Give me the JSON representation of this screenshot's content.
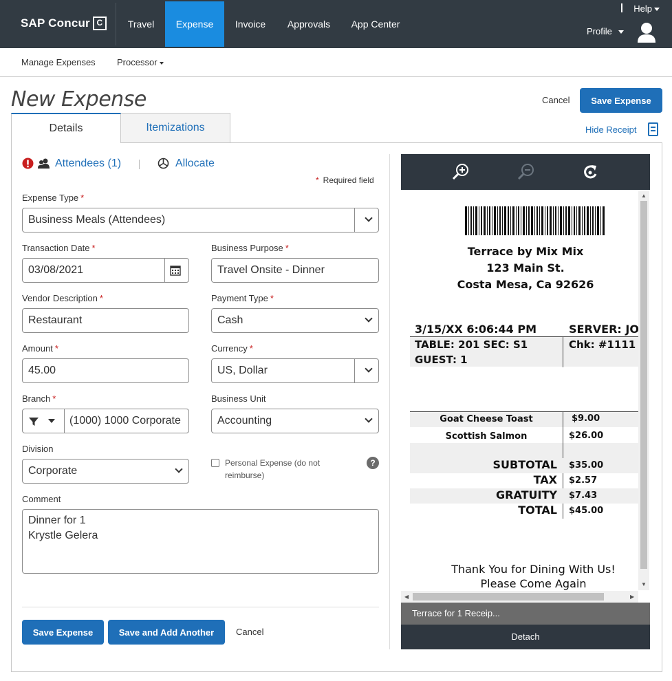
{
  "header": {
    "brand": "SAP Concur",
    "brand_mark": "C",
    "nav": [
      "Travel",
      "Expense",
      "Invoice",
      "Approvals",
      "App Center"
    ],
    "active_nav": "Expense",
    "help": "Help",
    "profile": "Profile"
  },
  "subnav": {
    "manage": "Manage Expenses",
    "processor": "Processor"
  },
  "page": {
    "title": "New Expense",
    "cancel": "Cancel",
    "save": "Save Expense",
    "hide_receipt": "Hide Receipt"
  },
  "tabs": [
    "Details",
    "Itemizations"
  ],
  "form": {
    "attendees": "Attendees (1)",
    "allocate": "Allocate",
    "required_note": "Required field",
    "expense_type_label": "Expense Type",
    "expense_type": "Business Meals (Attendees)",
    "transaction_date_label": "Transaction Date",
    "transaction_date": "03/08/2021",
    "business_purpose_label": "Business Purpose",
    "business_purpose": "Travel Onsite - Dinner",
    "vendor_label": "Vendor Description",
    "vendor": "Restaurant",
    "payment_type_label": "Payment Type",
    "payment_type": "Cash",
    "amount_label": "Amount",
    "amount": "45.00",
    "currency_label": "Currency",
    "currency": "US, Dollar",
    "branch_label": "Branch",
    "branch": "(1000) 1000 Corporate",
    "business_unit_label": "Business Unit",
    "business_unit": "Accounting",
    "division_label": "Division",
    "division": "Corporate",
    "personal_expense": "Personal Expense (do not reimburse)",
    "comment_label": "Comment",
    "comment": "Dinner for 1\nKrystle Gelera"
  },
  "actions": {
    "save": "Save Expense",
    "save_add": "Save and Add Another",
    "cancel": "Cancel"
  },
  "receipt": {
    "name": "Terrace by Mix Mix",
    "address1": "123 Main St.",
    "address2": "Costa Mesa, Ca 92626",
    "datetime": "3/15/XX 6:06:44 PM",
    "server": "SERVER: JOH",
    "table": "TABLE: 201 SEC: S1",
    "check": "Chk:  #1111",
    "guest": "GUEST: 1",
    "items": [
      {
        "name": "Goat Cheese Toast",
        "price": "$9.00"
      },
      {
        "name": "Scottish Salmon",
        "price": "$26.00"
      }
    ],
    "totals": [
      {
        "label": "SUBTOTAL",
        "value": "$35.00"
      },
      {
        "label": "TAX",
        "value": "$2.57"
      },
      {
        "label": "GRATUITY",
        "value": "$7.43"
      },
      {
        "label": "TOTAL",
        "value": "$45.00"
      }
    ],
    "thanks1": "Thank You for Dining With Us!",
    "thanks2": "Please Come Again",
    "caption": "Terrace for 1 Receip...",
    "detach": "Detach"
  },
  "colors": {
    "topbar": "#323b43",
    "active_tab": "#1a8ce0",
    "primary": "#1f6fb8",
    "required": "#c81f1f"
  }
}
